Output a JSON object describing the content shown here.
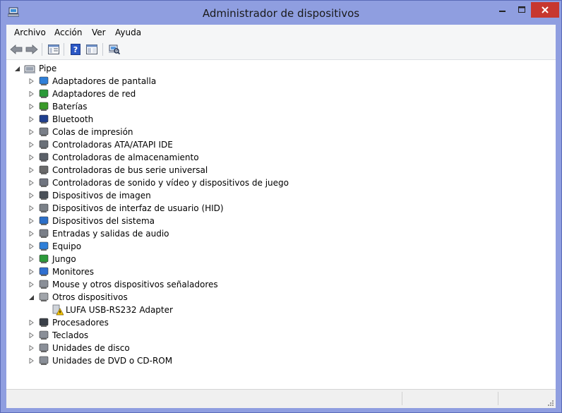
{
  "window": {
    "title": "Administrador de dispositivos"
  },
  "menu": {
    "items": [
      "Archivo",
      "Acción",
      "Ver",
      "Ayuda"
    ]
  },
  "tree": {
    "root": "Pipe",
    "categories": [
      "Adaptadores de pantalla",
      "Adaptadores de red",
      "Baterías",
      "Bluetooth",
      "Colas de impresión",
      "Controladoras ATA/ATAPI IDE",
      "Controladoras de almacenamiento",
      "Controladoras de bus serie universal",
      "Controladoras de sonido y vídeo y dispositivos de juego",
      "Dispositivos de imagen",
      "Dispositivos de interfaz de usuario (HID)",
      "Dispositivos del sistema",
      "Entradas y salidas de audio",
      "Equipo",
      "Jungo",
      "Monitores",
      "Mouse y otros dispositivos señaladores",
      "Otros dispositivos",
      "Procesadores",
      "Teclados",
      "Unidades de disco",
      "Unidades de DVD o CD-ROM"
    ],
    "other_devices_child": "LUFA USB-RS232 Adapter"
  },
  "icons": {
    "root": "computer-icon",
    "categories": [
      "display-adapter-icon",
      "network-adapter-icon",
      "battery-icon",
      "bluetooth-icon",
      "print-queue-icon",
      "ata-controller-icon",
      "storage-controller-icon",
      "usb-icon",
      "sound-icon",
      "camera-icon",
      "hid-icon",
      "system-devices-icon",
      "audio-io-icon",
      "computer-icon",
      "jungo-icon",
      "monitor-icon",
      "mouse-icon",
      "other-devices-icon",
      "processor-icon",
      "keyboard-icon",
      "disk-drive-icon",
      "dvd-drive-icon"
    ],
    "child": "warning-device-icon"
  }
}
